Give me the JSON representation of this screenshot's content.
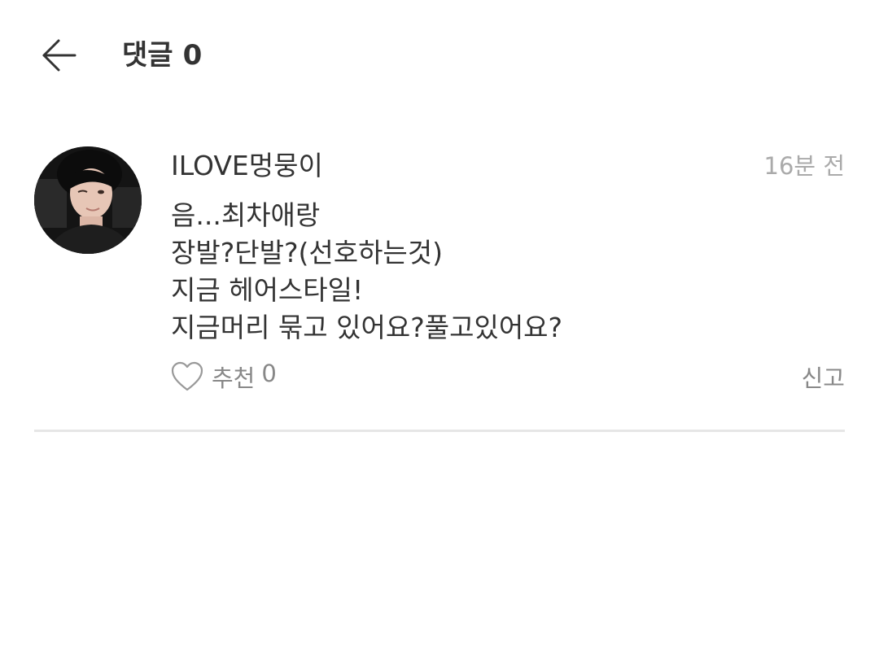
{
  "header": {
    "back_icon": "arrow-left-icon",
    "title": "댓글",
    "count": "0"
  },
  "comment": {
    "avatar_icon": "user-avatar-photo",
    "author": "ILOVE멍뭉이",
    "time": "16분 전",
    "lines": [
      "음...최차애랑",
      "장발?단발?(선호하는것)",
      "지금 헤어스타일!",
      "지금머리 묶고 있어요?풀고있어요?"
    ],
    "like_icon": "heart-outline-icon",
    "like_label": "추천",
    "like_count": "0",
    "report_label": "신고"
  },
  "colors": {
    "text_primary": "#333333",
    "text_secondary": "#888888",
    "text_time": "#aaaaaa",
    "divider": "#e6e6e6",
    "background": "#ffffff"
  }
}
